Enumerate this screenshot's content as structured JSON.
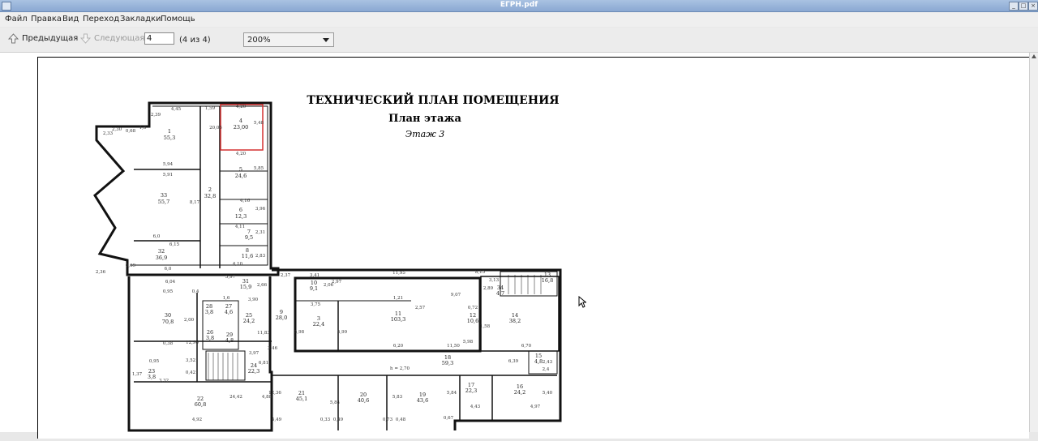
{
  "window": {
    "title": "ЕГРН.pdf"
  },
  "menu": [
    {
      "label": "Файл"
    },
    {
      "label": "Правка"
    },
    {
      "label": "Вид"
    },
    {
      "label": "Переход"
    },
    {
      "label": "Закладки"
    },
    {
      "label": "Помощь"
    }
  ],
  "toolbar": {
    "prev_label": "Предыдущая",
    "next_label": "Следующая",
    "page_value": "4",
    "page_count": "(4 из 4)",
    "zoom_value": "200%"
  },
  "document": {
    "title": "ТЕХНИЧЕСКИЙ ПЛАН ПОМЕЩЕНИЯ",
    "subtitle": "План этажа",
    "floor": "Этаж 3",
    "rooms": [
      {
        "num": "1",
        "area": "55,3"
      },
      {
        "num": "2",
        "area": "32,8"
      },
      {
        "num": "4",
        "area": "23,00"
      },
      {
        "num": "5",
        "area": "24,6"
      },
      {
        "num": "6",
        "area": "12,3"
      },
      {
        "num": "7",
        "area": "9,5"
      },
      {
        "num": "8",
        "area": "11,6"
      },
      {
        "num": "33",
        "area": "55,7"
      },
      {
        "num": "32",
        "area": "36,9"
      },
      {
        "num": "31",
        "area": "15,9"
      },
      {
        "num": "30",
        "area": "70,8"
      },
      {
        "num": "9",
        "area": "28,0"
      },
      {
        "num": "10",
        "area": "9,1"
      },
      {
        "num": "11",
        "area": "103,3"
      },
      {
        "num": "3",
        "area": "22,4"
      },
      {
        "num": "12",
        "area": "10,6"
      },
      {
        "num": "13",
        "area": "16,8"
      },
      {
        "num": "14",
        "area": "38,2"
      },
      {
        "num": "15",
        "area": "4,8"
      },
      {
        "num": "16",
        "area": "24,2"
      },
      {
        "num": "17",
        "area": "22,3"
      },
      {
        "num": "18",
        "area": "59,3"
      },
      {
        "num": "19",
        "area": "43,6"
      },
      {
        "num": "20",
        "area": "40,6"
      },
      {
        "num": "21",
        "area": "45,1"
      },
      {
        "num": "22",
        "area": "60,8"
      },
      {
        "num": "23",
        "area": "3,8"
      },
      {
        "num": "24",
        "area": "22,3"
      },
      {
        "num": "25",
        "area": "24,2"
      },
      {
        "num": "26",
        "area": "3,8"
      },
      {
        "num": "27",
        "area": "4,6"
      },
      {
        "num": "28",
        "area": "3,8"
      },
      {
        "num": "29",
        "area": "4,8"
      },
      {
        "num": "34",
        "area": "4,7"
      }
    ],
    "dimensions": [
      "4,45",
      "2,39",
      "1,59",
      "4,20",
      "20,05",
      "5,48",
      "2,30",
      "0,68",
      "1,5",
      "2,33",
      "5,94",
      "5,91",
      "4,20",
      "5,85",
      "8,17",
      "4,16",
      "3,96",
      "4,11",
      "2,31",
      "6,0",
      "6,15",
      "4,10",
      "2,83",
      "0,69",
      "6,0",
      "2,36",
      "6,04",
      "5,97",
      "2,66",
      "2,37",
      "3,41",
      "2,06",
      "2,97",
      "11,95",
      "8,15",
      "3,13",
      "2,89",
      "0,95",
      "0,4",
      "1,6",
      "3,90",
      "3,75",
      "5,98",
      "5,99",
      "1,21",
      "2,57",
      "9,07",
      "0,72",
      "1,58",
      "5,98",
      "6,70",
      "6,39",
      "2,43",
      "2,4",
      "2,00",
      "12,96",
      "0,38",
      "0,95",
      "3,52",
      "3,97",
      "6,81",
      "3,32",
      "3,46",
      "11,83",
      "6,20",
      "11,50",
      "h = 2,70",
      "24,42",
      "4,88",
      "4,92",
      "12,36",
      "5,84",
      "5,83",
      "5,84",
      "4,43",
      "4,97",
      "5,40",
      "4,49",
      "0,33",
      "0,49",
      "0,73",
      "0,48",
      "0,67",
      "0,42",
      "1,37",
      "1,11"
    ]
  }
}
